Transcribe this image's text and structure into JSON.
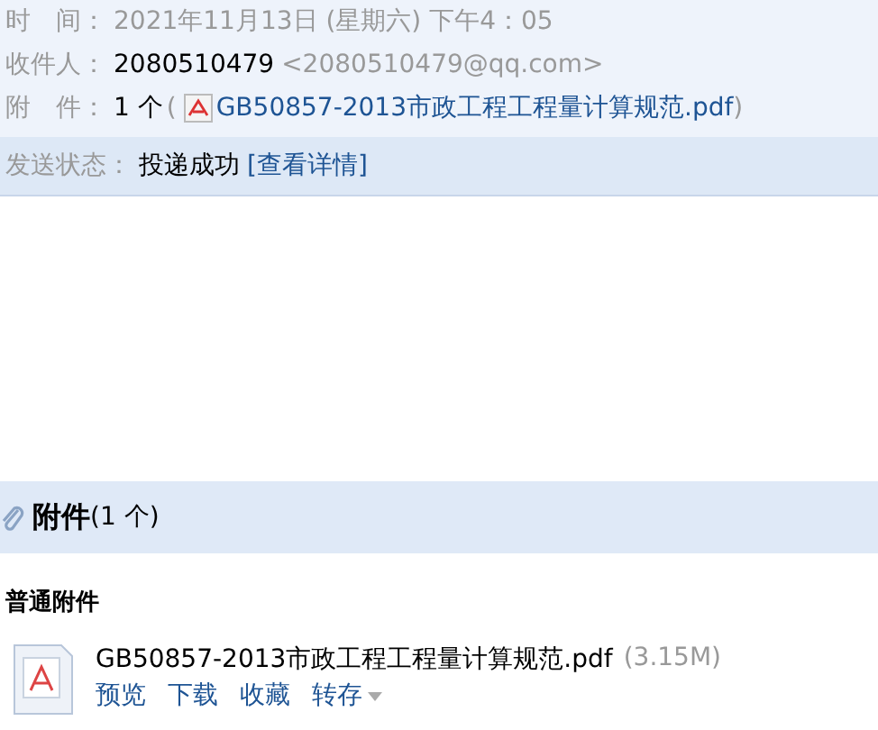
{
  "header": {
    "fields": [
      {
        "kind": "text",
        "label": "时　间：",
        "value": "2021年11月13日 (星期六) 下午4：05"
      },
      {
        "kind": "recipient",
        "label": "收件人：",
        "name": "2080510479",
        "address": "<2080510479@qq.com>"
      },
      {
        "kind": "attachment",
        "label": "附　件：",
        "count": "1 个",
        "open": "(",
        "file": "GB50857-2013市政工程工程量计算规范.pdf",
        "close": ")"
      }
    ]
  },
  "status": {
    "label": "发送状态：",
    "value": "投递成功",
    "link": "[查看详情]"
  },
  "attachments": {
    "title": "附件",
    "count": "(1 个)",
    "section": "普通附件",
    "files": [
      {
        "name": "GB50857-2013市政工程工程量计算规范.pdf",
        "size": "(3.15M)",
        "actions": [
          {
            "kind": "link",
            "label": "预览"
          },
          {
            "kind": "link",
            "label": "下载"
          },
          {
            "kind": "link",
            "label": "收藏"
          },
          {
            "kind": "menu",
            "label": "转存"
          }
        ]
      }
    ]
  }
}
